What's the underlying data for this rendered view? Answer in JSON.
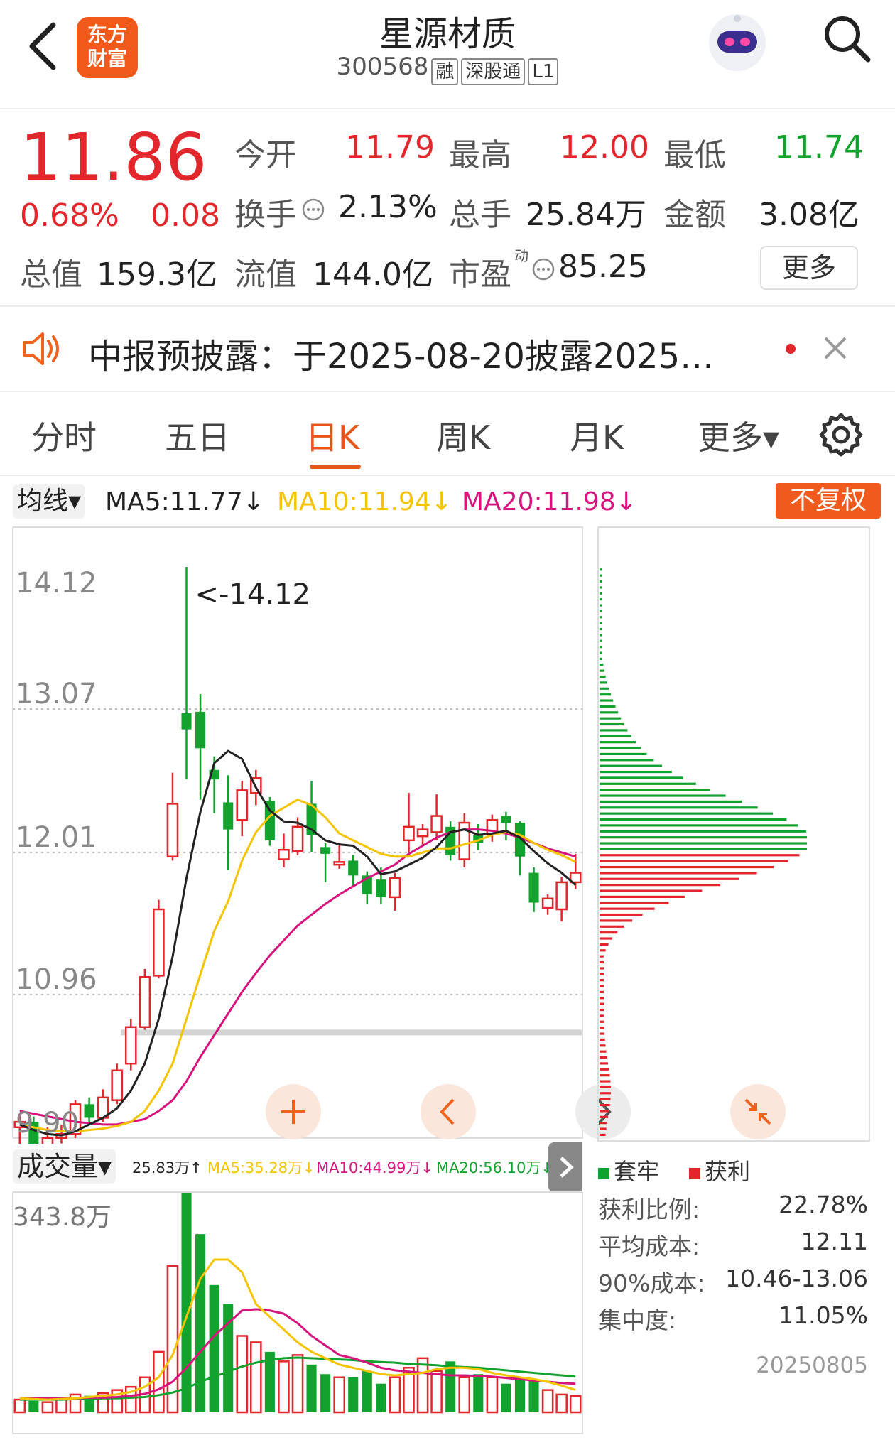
{
  "header": {
    "title": "星源材质",
    "code": "300568",
    "tags": [
      "融",
      "深股通",
      "L1"
    ],
    "logo_text": "东方财富"
  },
  "quote": {
    "price": "11.86",
    "change_pct": "0.68%",
    "change": "0.08",
    "open_label": "今开",
    "open": "11.79",
    "high_label": "最高",
    "high": "12.00",
    "low_label": "最低",
    "low": "11.74",
    "turnover_label": "换手",
    "turnover": "2.13%",
    "volume_label": "总手",
    "volume": "25.84万",
    "amount_label": "金额",
    "amount": "3.08亿",
    "mcap_label": "总值",
    "mcap": "159.3亿",
    "float_label": "流值",
    "float": "144.0亿",
    "pe_label": "市盈",
    "pe_sup": "动",
    "pe": "85.25",
    "more_label": "更多"
  },
  "notice": {
    "text": "中报预披露：于2025-08-20披露2025…"
  },
  "tabs": [
    "分时",
    "五日",
    "日K",
    "周K",
    "月K",
    "更多▾"
  ],
  "active_tab": "日K",
  "ma_bar": {
    "selector": "均线▾",
    "ma5": "MA5:11.77↓",
    "ma10": "MA10:11.94↓",
    "ma20": "MA20:11.98↓",
    "adjust": "不复权",
    "colors": {
      "ma5": "#222222",
      "ma10": "#f5c400",
      "ma20": "#d6147d"
    }
  },
  "kline_axis": {
    "ticks": [
      "14.12",
      "13.07",
      "12.01",
      "10.96",
      "9.90"
    ],
    "max_label": "<-14.12",
    "min_label": "9.90"
  },
  "volume_bar": {
    "selector": "成交量▾",
    "vol": "25.83万↑",
    "ma5": "MA5:35.28万↓",
    "ma10": "MA10:44.99万↓",
    "ma20": "MA20:56.10万↓",
    "max_label": "343.8万"
  },
  "chip": {
    "legend_trapped": "套牢",
    "legend_profit": "获利",
    "profit_ratio_label": "获利比例:",
    "profit_ratio": "22.78%",
    "avg_cost_label": "平均成本:",
    "avg_cost": "12.11",
    "cost90_label": "90%成本:",
    "cost90": "10.46-13.06",
    "concentration_label": "集中度:",
    "concentration": "11.05%",
    "date": "20250805"
  },
  "chart_data": {
    "type": "candlestick",
    "ylim": [
      9.9,
      14.12
    ],
    "up_color": "#e3262b",
    "down_color": "#12a22e",
    "candles": [
      [
        9.98,
        10.02,
        10.08,
        9.85
      ],
      [
        10.02,
        9.8,
        10.06,
        9.75
      ],
      [
        9.82,
        9.9,
        9.98,
        9.8
      ],
      [
        9.9,
        9.93,
        10.0,
        9.86
      ],
      [
        9.93,
        10.15,
        10.18,
        9.9
      ],
      [
        10.15,
        10.05,
        10.2,
        10.0
      ],
      [
        10.05,
        10.2,
        10.26,
        10.02
      ],
      [
        10.18,
        10.4,
        10.45,
        10.15
      ],
      [
        10.45,
        10.72,
        10.78,
        10.4
      ],
      [
        10.72,
        11.09,
        11.15,
        10.7
      ],
      [
        11.1,
        11.59,
        11.66,
        11.08
      ],
      [
        11.98,
        12.37,
        12.6,
        11.95
      ],
      [
        13.04,
        12.92,
        14.12,
        12.55
      ],
      [
        13.05,
        12.78,
        13.18,
        12.4
      ],
      [
        12.62,
        12.55,
        12.72,
        12.3
      ],
      [
        12.38,
        12.18,
        12.58,
        11.88
      ],
      [
        12.25,
        12.47,
        12.54,
        12.13
      ],
      [
        12.45,
        12.56,
        12.62,
        12.36
      ],
      [
        12.39,
        12.1,
        12.42,
        12.06
      ],
      [
        11.96,
        12.03,
        12.15,
        11.9
      ],
      [
        12.02,
        12.2,
        12.27,
        11.99
      ],
      [
        12.37,
        12.14,
        12.54,
        12.01
      ],
      [
        12.05,
        12.0,
        12.08,
        11.79
      ],
      [
        11.92,
        11.94,
        12.08,
        11.89
      ],
      [
        11.95,
        11.84,
        11.99,
        11.76
      ],
      [
        11.84,
        11.7,
        11.87,
        11.63
      ],
      [
        11.81,
        11.68,
        11.9,
        11.63
      ],
      [
        11.68,
        11.82,
        11.86,
        11.58
      ],
      [
        12.1,
        12.2,
        12.45,
        12.01
      ],
      [
        12.13,
        12.18,
        12.22,
        12.06
      ],
      [
        12.16,
        12.28,
        12.44,
        12.1
      ],
      [
        12.2,
        11.99,
        12.24,
        11.95
      ],
      [
        11.96,
        12.23,
        12.3,
        11.9
      ],
      [
        12.14,
        12.08,
        12.22,
        12.03
      ],
      [
        12.15,
        12.25,
        12.29,
        12.09
      ],
      [
        12.28,
        12.23,
        12.31,
        12.1
      ],
      [
        12.23,
        11.98,
        12.24,
        11.84
      ],
      [
        11.86,
        11.64,
        11.9,
        11.57
      ],
      [
        11.6,
        11.67,
        11.7,
        11.55
      ],
      [
        11.59,
        11.79,
        11.83,
        11.5
      ],
      [
        11.79,
        11.86,
        12.0,
        11.74
      ]
    ],
    "ma5": [
      10.0,
      9.96,
      9.93,
      9.92,
      9.95,
      10.0,
      10.05,
      10.12,
      10.25,
      10.45,
      10.78,
      11.24,
      11.82,
      12.31,
      12.67,
      12.76,
      12.7,
      12.49,
      12.32,
      12.24,
      12.23,
      12.18,
      12.1,
      12.07,
      12.06,
      11.98,
      11.85,
      11.87,
      11.92,
      11.97,
      12.05,
      12.16,
      12.18,
      12.14,
      12.15,
      12.17,
      12.12,
      12.02,
      11.93,
      11.86,
      11.77
    ],
    "ma10": [
      10.0,
      9.98,
      9.96,
      9.95,
      9.95,
      9.96,
      9.97,
      9.99,
      10.02,
      10.1,
      10.25,
      10.45,
      10.78,
      11.11,
      11.43,
      11.65,
      11.95,
      12.16,
      12.28,
      12.34,
      12.4,
      12.36,
      12.27,
      12.15,
      12.1,
      12.05,
      12.0,
      11.98,
      11.98,
      12.01,
      12.04,
      12.04,
      12.07,
      12.1,
      12.14,
      12.16,
      12.14,
      12.08,
      12.03,
      11.99,
      11.94
    ],
    "ma20": [
      10.1,
      10.08,
      10.06,
      10.04,
      10.02,
      10.01,
      10.0,
      10.0,
      10.02,
      10.04,
      10.1,
      10.18,
      10.32,
      10.5,
      10.66,
      10.82,
      10.98,
      11.12,
      11.25,
      11.36,
      11.47,
      11.55,
      11.63,
      11.7,
      11.76,
      11.82,
      11.87,
      11.92,
      12.0,
      12.06,
      12.12,
      12.16,
      12.18,
      12.18,
      12.17,
      12.15,
      12.12,
      12.08,
      12.04,
      12.01,
      11.98
    ],
    "volume_wan": [
      20,
      18,
      16,
      20,
      28,
      26,
      30,
      35,
      40,
      55,
      95,
      230,
      343.8,
      280,
      200,
      170,
      120,
      110,
      95,
      80,
      90,
      75,
      60,
      55,
      55,
      65,
      45,
      55,
      70,
      85,
      65,
      80,
      55,
      60,
      55,
      45,
      55,
      50,
      35,
      28,
      25.83
    ],
    "volume_ma5": [
      22,
      21,
      20,
      21,
      22,
      24,
      26,
      28,
      32,
      40,
      55,
      90,
      150,
      210,
      240,
      240,
      220,
      170,
      150,
      130,
      110,
      95,
      85,
      75,
      70,
      65,
      60,
      58,
      60,
      62,
      68,
      70,
      70,
      68,
      62,
      58,
      55,
      52,
      48,
      42,
      35.28
    ],
    "volume_ma10": [
      22,
      22,
      22,
      22,
      22,
      23,
      23,
      24,
      26,
      29,
      36,
      48,
      70,
      95,
      120,
      140,
      160,
      162,
      160,
      155,
      140,
      120,
      105,
      90,
      85,
      78,
      70,
      66,
      64,
      62,
      60,
      58,
      58,
      57,
      56,
      54,
      52,
      50,
      48,
      46,
      44.99
    ],
    "volume_ma20": [
      20,
      20,
      20,
      20,
      21,
      21,
      22,
      22,
      23,
      24,
      27,
      31,
      38,
      48,
      56,
      64,
      72,
      78,
      82,
      85,
      86,
      85,
      84,
      83,
      82,
      80,
      79,
      78,
      76,
      75,
      74,
      72,
      71,
      70,
      68,
      66,
      64,
      62,
      60,
      58,
      56.1
    ]
  }
}
